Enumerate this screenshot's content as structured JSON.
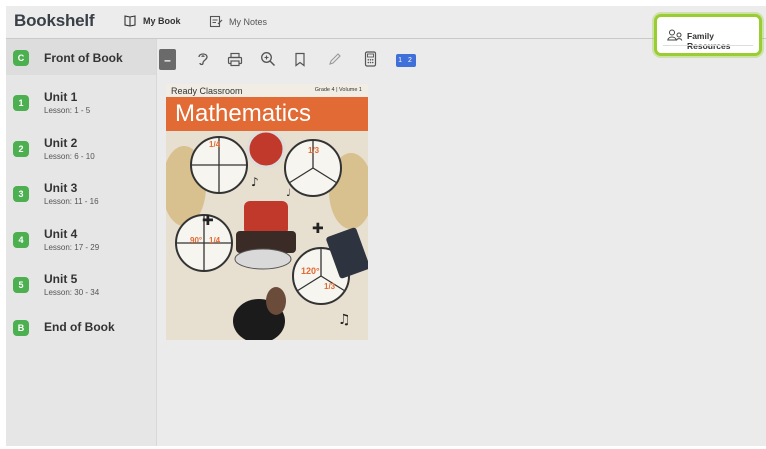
{
  "header": {
    "brand": "Bookshelf",
    "tabs": [
      {
        "label": "My Book"
      },
      {
        "label": "My Notes"
      }
    ],
    "family_resources": "Family Resources"
  },
  "sidebar": {
    "items": [
      {
        "badge": "C",
        "title": "Front of Book",
        "subtitle": ""
      },
      {
        "badge": "1",
        "title": "Unit 1",
        "subtitle": "Lesson: 1 - 5"
      },
      {
        "badge": "2",
        "title": "Unit 2",
        "subtitle": "Lesson: 6 - 10"
      },
      {
        "badge": "3",
        "title": "Unit 3",
        "subtitle": "Lesson: 11 - 16"
      },
      {
        "badge": "4",
        "title": "Unit 4",
        "subtitle": "Lesson: 17 - 29"
      },
      {
        "badge": "5",
        "title": "Unit 5",
        "subtitle": "Lesson: 30 - 34"
      },
      {
        "badge": "B",
        "title": "End of Book",
        "subtitle": ""
      }
    ]
  },
  "toolbar": {
    "minus_label": "–",
    "page_indicator": "1 2",
    "icons": [
      "minus-icon",
      "listen-icon",
      "print-icon",
      "zoom-icon",
      "bookmark-icon",
      "pencil-icon",
      "calculator-icon",
      "two-page-icon"
    ]
  },
  "cover": {
    "publisher": "Ready Classroom",
    "grade": "Grade 4 | Volume 1",
    "title": "Mathematics",
    "fractions": [
      "1/4",
      "1/3",
      "90°",
      "1/4",
      "120°",
      "1/3"
    ]
  },
  "colors": {
    "accent_green": "#9acd32",
    "badge_green": "#4caf50",
    "title_orange": "#e26a34",
    "page_blue": "#3f6fd8"
  }
}
